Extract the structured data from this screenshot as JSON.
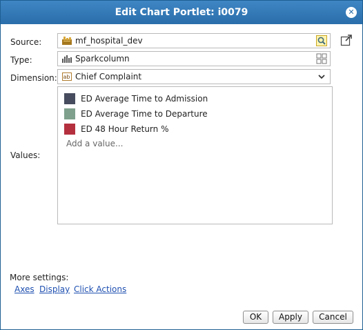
{
  "dialog": {
    "title": "Edit Chart Portlet: i0079",
    "close_icon": "close-icon"
  },
  "form": {
    "source": {
      "label": "Source:",
      "value": "mf_hospital_dev",
      "icon": "database-icon",
      "action_icon": "search-icon"
    },
    "type": {
      "label": "Type:",
      "value": "Sparkcolumn",
      "icon": "sparkcolumn-chart-icon",
      "action_icon": "grid-icon"
    },
    "dimension": {
      "label": "Dimension:",
      "value": "Chief Complaint",
      "icon": "text-field-icon",
      "action_icon": "chevron-down-icon"
    },
    "values": {
      "label": "Values:",
      "items": [
        {
          "text": "ED Average Time to Admission",
          "color": "#474d5e"
        },
        {
          "text": "ED Average Time to Departure",
          "color": "#7ea08c"
        },
        {
          "text": "ED 48 Hour Return %",
          "color": "#b5303f"
        }
      ],
      "add_placeholder": "Add a value..."
    }
  },
  "more_settings": {
    "label": "More settings:",
    "links": [
      "Axes",
      "Display",
      "Click Actions"
    ]
  },
  "buttons": {
    "ok": "OK",
    "apply": "Apply",
    "cancel": "Cancel"
  }
}
